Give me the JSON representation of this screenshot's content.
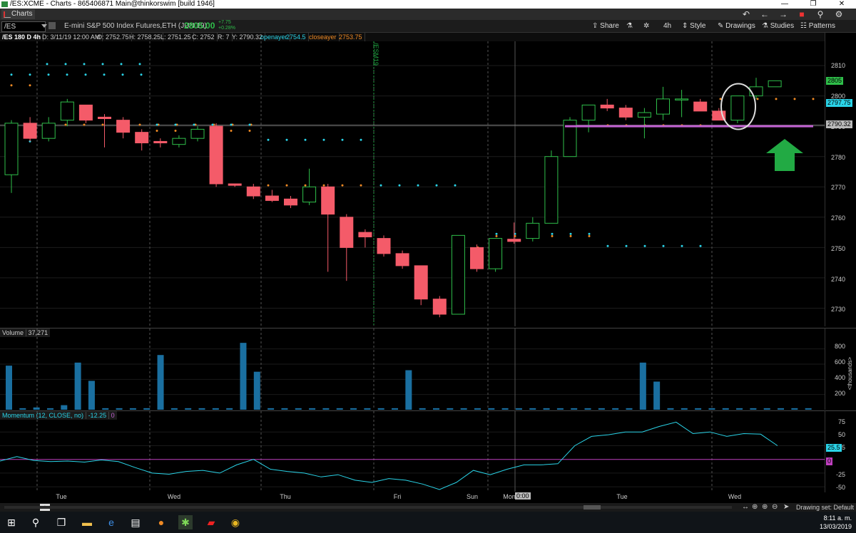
{
  "window": {
    "title": "/ES:XCME - Charts - 865406871 Main@thinkorswim [build 1946]",
    "minimize": "—",
    "maximize": "❐",
    "close": "✕"
  },
  "toolbar": {
    "tab_label": "Charts",
    "icons": [
      "undo-icon",
      "back-arrow-icon",
      "forward-arrow-icon",
      "flag-icon",
      "pin-icon",
      "gear-icon"
    ]
  },
  "symbol_bar": {
    "symbol": "/ES",
    "description": "E-mini S&P 500 Index Futures,ETH (JUN 19)",
    "last_price": "2805.00",
    "change": "+7.75",
    "change_pct": "+0.28%",
    "buttons": {
      "share": "Share",
      "timeframe": "4h",
      "style": "Style",
      "drawings": "Drawings",
      "studies": "Studies",
      "patterns": "Patterns"
    }
  },
  "info_row": {
    "aggregation": "/ES 180 D 4h",
    "date": "D: 3/11/19 12:00 AM",
    "open": "O: 2752.75",
    "high": "H: 2758.25",
    "low": "L: 2751.25",
    "close": "C: 2752",
    "range": "R: 7",
    "y": "Y: 2790.32",
    "openayer_label": "openayer",
    "openayer_value": "2754.5",
    "closeayer_label": "closeayer",
    "closeayer_value": "2753.75"
  },
  "contract_marker": "/ESM19",
  "price_axis": {
    "labels": [
      "2810",
      "2800",
      "2790",
      "2780",
      "2770",
      "2760",
      "2750",
      "2740",
      "2730"
    ],
    "tags": {
      "last": "2805",
      "close_level": "2797.75",
      "crosshair": "2790.32"
    }
  },
  "volume_panel": {
    "label": "Volume",
    "value": "37,271",
    "axis_labels": [
      "800",
      "600",
      "400",
      "200"
    ],
    "unit_label": "<thousands>"
  },
  "momentum_panel": {
    "label": "Momentum (12, CLOSE, no)",
    "value": "-12.25",
    "zero": "0",
    "axis_labels": [
      "75",
      "50",
      "25",
      "-25",
      "-50"
    ],
    "tags": {
      "current": "25.5",
      "zero": "0"
    }
  },
  "x_axis": {
    "labels": [
      "Tue",
      "Wed",
      "Thu",
      "Fri",
      "Sun",
      "Mon",
      "Tue",
      "Wed"
    ],
    "cursor_time": "0:00"
  },
  "status_bar": {
    "drawing_set": "Drawing set: Default"
  },
  "taskbar": {
    "time": "8:11 a. m.",
    "date": "13/03/2019"
  },
  "colors": {
    "up": "#2fbf4a",
    "down": "#f45b69",
    "cyan": "#2ad4e8",
    "orange": "#f08a24",
    "purple": "#c060d0",
    "volume": "#1a6fa0",
    "momentum": "#2ad4e8",
    "zero_line": "#c040c0",
    "arrow": "#22aa44"
  },
  "chart_data": {
    "type": "candlestick",
    "title": "/ES 180 D 4h",
    "ylim": [
      2724,
      2818
    ],
    "candles": [
      {
        "o": 2774,
        "h": 2792,
        "l": 2768,
        "c": 2791
      },
      {
        "o": 2791,
        "h": 2793,
        "l": 2785,
        "c": 2786
      },
      {
        "o": 2786,
        "h": 2793,
        "l": 2785,
        "c": 2791
      },
      {
        "o": 2792,
        "h": 2799,
        "l": 2790,
        "c": 2798
      },
      {
        "o": 2797,
        "h": 2797,
        "l": 2791,
        "c": 2792
      },
      {
        "o": 2793,
        "h": 2794,
        "l": 2783,
        "c": 2792.5
      },
      {
        "o": 2792,
        "h": 2793,
        "l": 2786,
        "c": 2788
      },
      {
        "o": 2788,
        "h": 2789,
        "l": 2782,
        "c": 2784.5
      },
      {
        "o": 2785,
        "h": 2786,
        "l": 2783,
        "c": 2784.5
      },
      {
        "o": 2784,
        "h": 2787,
        "l": 2783,
        "c": 2786
      },
      {
        "o": 2786,
        "h": 2790,
        "l": 2785,
        "c": 2789
      },
      {
        "o": 2790,
        "h": 2791,
        "l": 2770,
        "c": 2771
      },
      {
        "o": 2771,
        "h": 2771,
        "l": 2770,
        "c": 2770.5
      },
      {
        "o": 2770,
        "h": 2771,
        "l": 2766,
        "c": 2767
      },
      {
        "o": 2767,
        "h": 2769,
        "l": 2765,
        "c": 2765.5
      },
      {
        "o": 2766,
        "h": 2767,
        "l": 2763,
        "c": 2764
      },
      {
        "o": 2765,
        "h": 2776,
        "l": 2764,
        "c": 2770
      },
      {
        "o": 2770,
        "h": 2771,
        "l": 2742,
        "c": 2761
      },
      {
        "o": 2760,
        "h": 2761,
        "l": 2739,
        "c": 2750
      },
      {
        "o": 2755,
        "h": 2756,
        "l": 2750,
        "c": 2753.5
      },
      {
        "o": 2753,
        "h": 2754,
        "l": 2747,
        "c": 2748
      },
      {
        "o": 2748,
        "h": 2749,
        "l": 2743,
        "c": 2744
      },
      {
        "o": 2744,
        "h": 2744,
        "l": 2731,
        "c": 2733
      },
      {
        "o": 2733,
        "h": 2734,
        "l": 2727,
        "c": 2728
      },
      {
        "o": 2728,
        "h": 2754,
        "l": 2728,
        "c": 2754
      },
      {
        "o": 2750,
        "h": 2751,
        "l": 2742,
        "c": 2743
      },
      {
        "o": 2743,
        "h": 2753,
        "l": 2742,
        "c": 2753
      },
      {
        "o": 2752.75,
        "h": 2758.25,
        "l": 2751.25,
        "c": 2752
      },
      {
        "o": 2753,
        "h": 2760,
        "l": 2752,
        "c": 2758
      },
      {
        "o": 2758,
        "h": 2782,
        "l": 2758,
        "c": 2780
      },
      {
        "o": 2780,
        "h": 2793,
        "l": 2780,
        "c": 2792
      },
      {
        "o": 2792,
        "h": 2797,
        "l": 2788,
        "c": 2797
      },
      {
        "o": 2797,
        "h": 2799,
        "l": 2795,
        "c": 2796
      },
      {
        "o": 2796,
        "h": 2797,
        "l": 2792,
        "c": 2793
      },
      {
        "o": 2793,
        "h": 2796,
        "l": 2786,
        "c": 2794.5
      },
      {
        "o": 2794,
        "h": 2803,
        "l": 2792,
        "c": 2799
      },
      {
        "o": 2799,
        "h": 2802,
        "l": 2793,
        "c": 2799
      },
      {
        "o": 2798,
        "h": 2799,
        "l": 2795,
        "c": 2795
      },
      {
        "o": 2795,
        "h": 2796,
        "l": 2792,
        "c": 2792
      },
      {
        "o": 2792,
        "h": 2800,
        "l": 2791,
        "c": 2800
      },
      {
        "o": 2800,
        "h": 2806,
        "l": 2799,
        "c": 2803
      },
      {
        "o": 2803,
        "h": 2805,
        "l": 2803,
        "c": 2805
      }
    ],
    "volume": [
      580,
      20,
      30,
      20,
      60,
      620,
      380,
      20,
      20,
      20,
      20,
      720,
      20,
      20,
      20,
      20,
      20,
      880,
      500,
      20,
      20,
      20,
      20,
      20,
      20,
      20,
      20,
      20,
      20,
      520,
      20,
      20,
      20,
      20,
      20,
      20,
      20,
      20,
      20,
      20,
      20,
      20,
      20,
      20,
      20,
      20,
      620,
      370,
      20,
      20,
      20,
      20,
      20,
      20,
      20,
      20,
      20,
      20,
      20
    ],
    "momentum": [
      -3,
      5,
      -2,
      -4,
      -3,
      -5,
      -1,
      -4,
      -15,
      -25,
      -27,
      -22,
      -20,
      -25,
      -10,
      0,
      -18,
      -22,
      -25,
      -32,
      -28,
      -38,
      -42,
      -35,
      -38,
      -45,
      -55,
      -42,
      -20,
      -28,
      -18,
      -10,
      -10,
      -8,
      25,
      42,
      45,
      50,
      50,
      60,
      68,
      47,
      50,
      42,
      47,
      46,
      25
    ],
    "momentum_ylim": [
      -55,
      75
    ]
  }
}
